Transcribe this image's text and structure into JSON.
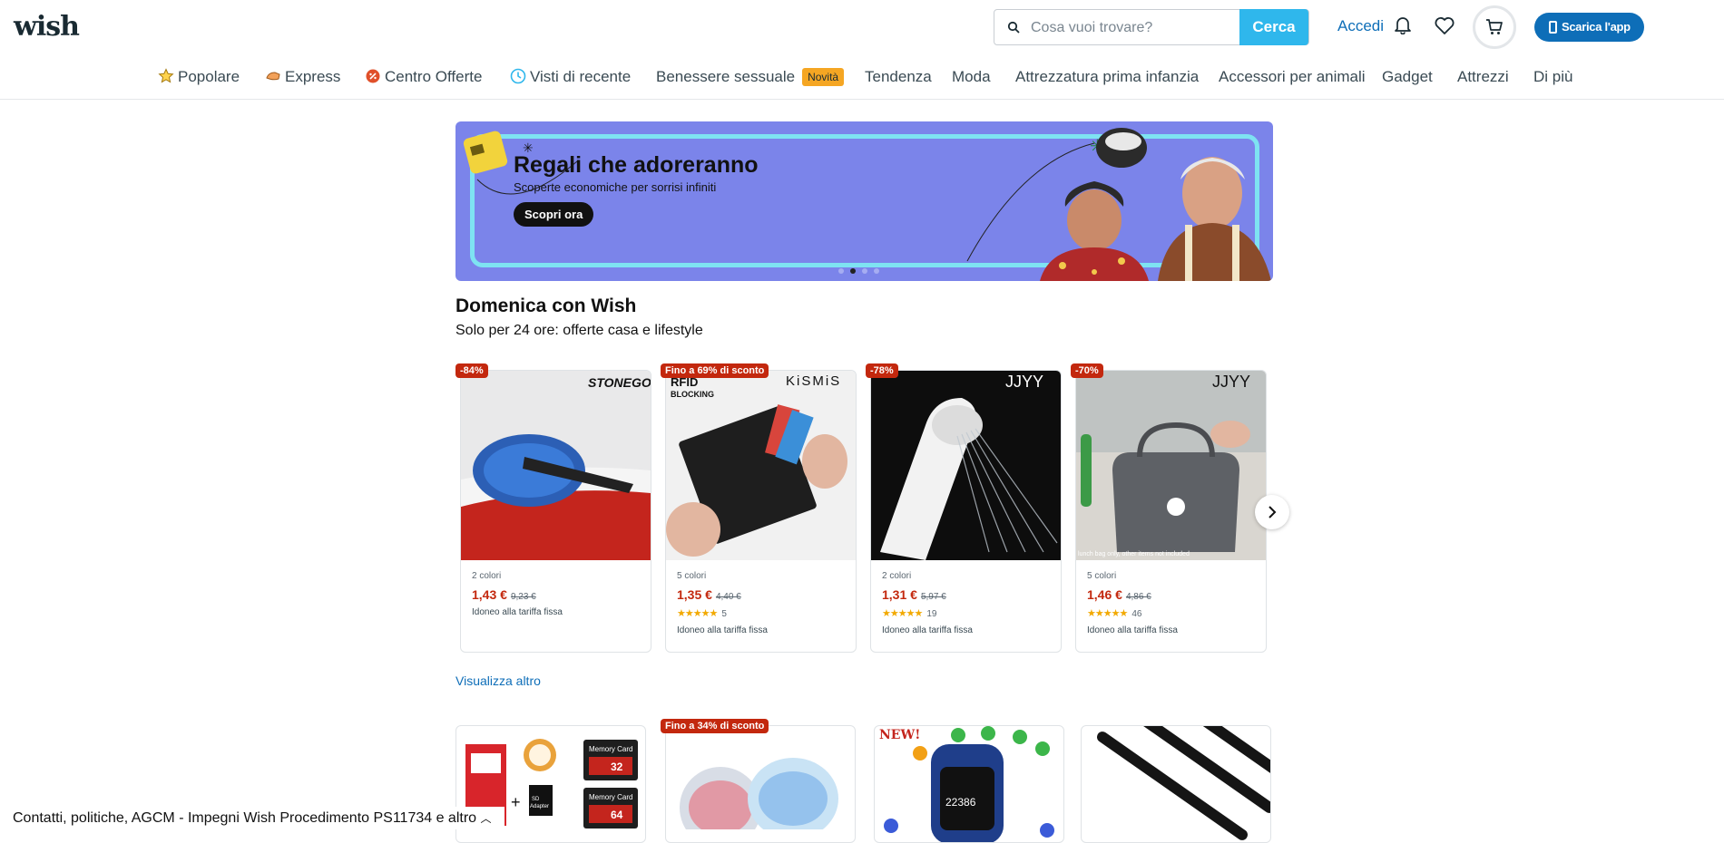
{
  "header": {
    "logo": "wish",
    "search_placeholder": "Cosa vuoi trovare?",
    "search_button": "Cerca",
    "login": "Accedi",
    "app_button": "Scarica l'app"
  },
  "nav": [
    {
      "label": "Popolare",
      "icon": "star-icon"
    },
    {
      "label": "Express",
      "icon": "express-icon"
    },
    {
      "label": "Centro Offerte",
      "icon": "deals-icon"
    },
    {
      "label": "Visti di recente",
      "icon": "clock-icon"
    },
    {
      "label": "Benessere sessuale",
      "badge": "Novità"
    },
    {
      "label": "Tendenza"
    },
    {
      "label": "Moda"
    },
    {
      "label": "Attrezzatura prima infanzia"
    },
    {
      "label": "Accessori per animali"
    },
    {
      "label": "Gadget"
    },
    {
      "label": "Attrezzi"
    },
    {
      "label": "Di più"
    }
  ],
  "banner": {
    "title": "Regali che adoreranno",
    "subtitle": "Scoperte economiche per sorrisi infiniti",
    "cta": "Scopri ora",
    "slides": 4,
    "active_slide": 2
  },
  "section": {
    "title": "Domenica con Wish",
    "subtitle": "Solo per 24 ore: offerte casa e lifestyle",
    "view_more": "Visualizza altro"
  },
  "products": [
    {
      "badge": "-84%",
      "brand": "STONEGO",
      "colors": "2 colori",
      "price": "1,43 €",
      "old_price": "9,23 €",
      "rating": null,
      "reviews": "",
      "note": "Idoneo alla tariffa fissa"
    },
    {
      "badge": "Fino a 69% di sconto",
      "brand": "KiSMiS",
      "colors": "5 colori",
      "price": "1,35 €",
      "old_price": "4,40 €",
      "rating": 4.5,
      "reviews": "5",
      "note": "Idoneo alla tariffa fissa",
      "img_text": "RFID BLOCKING"
    },
    {
      "badge": "-78%",
      "brand": "JJYY",
      "colors": "2 colori",
      "price": "1,31 €",
      "old_price": "5,97 €",
      "rating": 4.5,
      "reviews": "19",
      "note": "Idoneo alla tariffa fissa"
    },
    {
      "badge": "-70%",
      "brand": "JJYY",
      "colors": "5 colori",
      "price": "1,46 €",
      "old_price": "4,86 €",
      "rating": 4.5,
      "reviews": "46",
      "note": "Idoneo alla tariffa fissa",
      "img_text": "lunch bag only, other items not included"
    }
  ],
  "products_row2": [
    {
      "badge": "",
      "img_text": [
        "Memory Card",
        "32",
        "Memory Card",
        "64",
        "SD Adapter"
      ]
    },
    {
      "badge": "Fino a 34% di sconto"
    },
    {
      "badge": "",
      "img_text": [
        "NEW!",
        "22386"
      ]
    },
    {
      "badge": ""
    }
  ],
  "footer": {
    "text": "Contatti, politiche, AGCM - Impegni Wish Procedimento PS11734 e altro"
  },
  "colors": {
    "brand_blue": "#0e6eb8",
    "search_button": "#2fb7ec",
    "discount_red": "#c3280e",
    "banner_bg": "#7b84ea",
    "new_badge": "#f5a623"
  }
}
